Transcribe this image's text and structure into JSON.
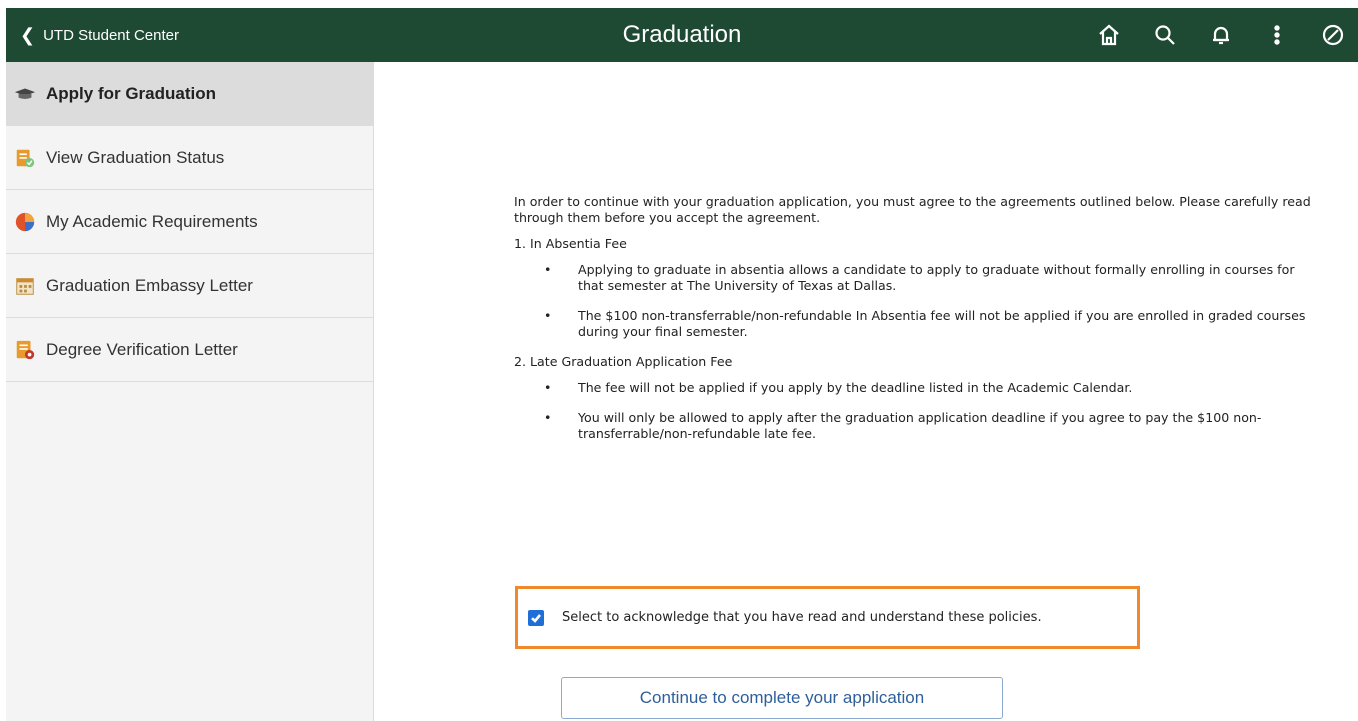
{
  "header": {
    "back_label": "UTD Student Center",
    "title": "Graduation",
    "icons": [
      "home-icon",
      "search-icon",
      "bell-icon",
      "more-vertical-icon",
      "nav-bar-icon"
    ]
  },
  "sidebar": {
    "items": [
      {
        "label": "Apply for Graduation",
        "icon": "graduation-cap-icon",
        "active": true
      },
      {
        "label": "View Graduation Status",
        "icon": "status-document-icon",
        "active": false
      },
      {
        "label": "My Academic Requirements",
        "icon": "pie-chart-icon",
        "active": false
      },
      {
        "label": "Graduation Embassy Letter",
        "icon": "calendar-icon",
        "active": false
      },
      {
        "label": "Degree Verification Letter",
        "icon": "document-icon",
        "active": false
      }
    ]
  },
  "main": {
    "intro": "In order to continue with your graduation application, you must agree to the agreements outlined below. Please carefully read through them before you accept the agreement.",
    "section1": {
      "title": "1. In Absentia Fee",
      "bullets": [
        "Applying to graduate in absentia allows a candidate to apply to graduate without formally enrolling in courses for that semester at The University of Texas at Dallas.",
        "The $100 non-transferrable/non-refundable In Absentia fee will not be applied if you are enrolled in graded courses during your final semester."
      ]
    },
    "section2": {
      "title": "2. Late Graduation Application Fee",
      "bullets": [
        "The fee will not be applied if you apply by the deadline listed in the Academic Calendar.",
        "You will only be allowed to apply after the graduation application deadline if you agree to pay the $100 non-transferrable/non-refundable late fee."
      ]
    },
    "acknowledge_label": "Select to acknowledge that you have read and understand these policies.",
    "acknowledge_checked": true,
    "continue_label": "Continue to complete your application"
  },
  "colors": {
    "header_bg": "#1e4a34",
    "highlight_border": "#ee8a2b",
    "checkbox": "#1f6fd6",
    "button_text": "#2f5f9a"
  }
}
